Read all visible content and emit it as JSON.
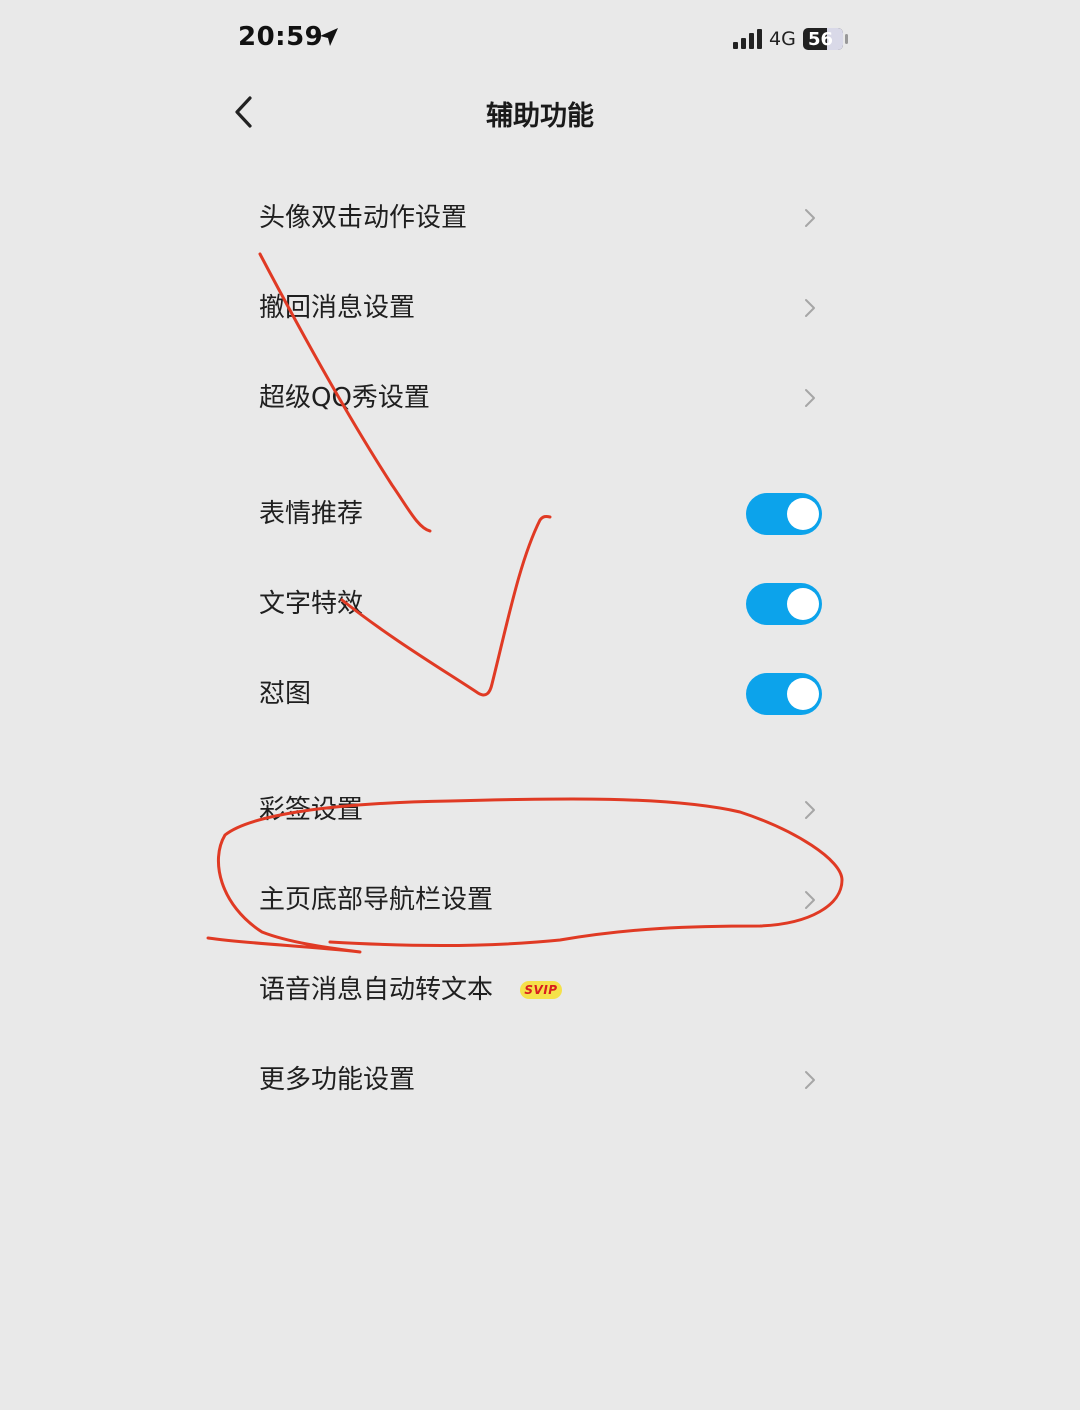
{
  "status_bar": {
    "time": "20:59",
    "network": "4G",
    "battery": "56"
  },
  "header": {
    "title": "辅助功能"
  },
  "settings": {
    "avatar_double_tap": {
      "label": "头像双击动作设置"
    },
    "recall_message": {
      "label": "撤回消息设置"
    },
    "super_qq_show": {
      "label": "超级QQ秀设置"
    },
    "sticker_recommend": {
      "label": "表情推荐",
      "enabled": true
    },
    "text_effects": {
      "label": "文字特效",
      "enabled": true
    },
    "duitu": {
      "label": "怼图",
      "enabled": true
    },
    "color_sign": {
      "label": "彩签设置"
    },
    "bottom_nav": {
      "label": "主页底部导航栏设置"
    },
    "voice_to_text": {
      "label": "语音消息自动转文本",
      "badge": "SVIP"
    },
    "more_settings": {
      "label": "更多功能设置"
    }
  },
  "colors": {
    "background": "#e9e9e9",
    "toggle_on": "#0ca3eb",
    "annotation": "#e03a24",
    "badge_bg": "#f5e14a",
    "badge_text": "#d81e1e"
  }
}
